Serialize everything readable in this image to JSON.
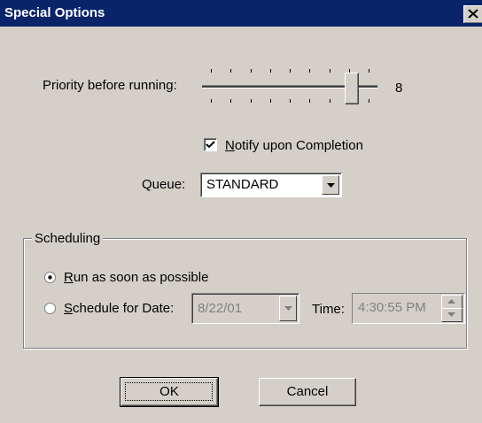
{
  "window": {
    "title": "Special Options",
    "close_icon": "close-icon"
  },
  "priority": {
    "label": "Priority before running:",
    "value": "8",
    "min": 1,
    "max": 9,
    "current": 8
  },
  "notify": {
    "label_mnemonic": "N",
    "label_rest": "otify upon Completion",
    "checked": true
  },
  "queue": {
    "label": "Queue:",
    "value": "STANDARD"
  },
  "scheduling": {
    "legend": "Scheduling",
    "run_asap": {
      "mnemonic": "R",
      "rest": "un as soon as possible",
      "selected": true
    },
    "schedule_date": {
      "mnemonic": "S",
      "rest": "chedule for Date:",
      "selected": false,
      "date_value": "8/22/01"
    },
    "time": {
      "label": "Time:",
      "value": "4:30:55 PM"
    }
  },
  "buttons": {
    "ok": "OK",
    "cancel": "Cancel"
  },
  "colors": {
    "title_bar": "#0a246a",
    "face": "#d4d0c8"
  }
}
